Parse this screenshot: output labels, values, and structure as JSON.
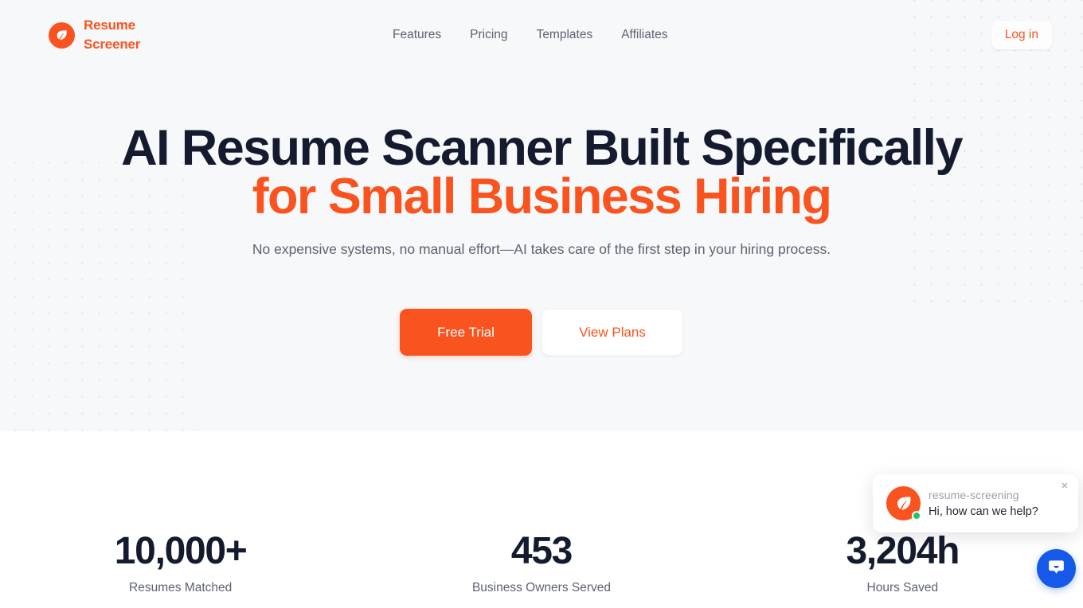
{
  "brand": {
    "name_line1": "Resume",
    "name_line2": "Screener",
    "icon": "leaf-icon",
    "accent_color": "#f9531f"
  },
  "nav": {
    "links": [
      {
        "label": "Features"
      },
      {
        "label": "Pricing"
      },
      {
        "label": "Templates"
      },
      {
        "label": "Affiliates"
      }
    ],
    "login_label": "Log in"
  },
  "hero": {
    "headline_line1": "AI Resume Scanner Built Specifically",
    "headline_line2": "for Small Business Hiring",
    "subheadline": "No expensive systems, no manual effort—AI takes care of the first step in your hiring process.",
    "primary_cta": "Free Trial",
    "secondary_cta": "View Plans",
    "background_color": "#f7f8fa",
    "headline_color": "#141b2e",
    "accent_color": "#f9531f"
  },
  "stats": [
    {
      "value": "10,000+",
      "label": "Resumes Matched"
    },
    {
      "value": "453",
      "label": "Business Owners Served"
    },
    {
      "value": "3,204h",
      "label": "Hours Saved"
    }
  ],
  "chat": {
    "title": "resume-screening",
    "message": "Hi, how can we help?",
    "close_label": "×",
    "avatar_icon": "leaf-icon",
    "status": "online",
    "status_color": "#22c55e",
    "launcher_icon": "chat-bubble-icon",
    "launcher_color": "#1559e8"
  }
}
